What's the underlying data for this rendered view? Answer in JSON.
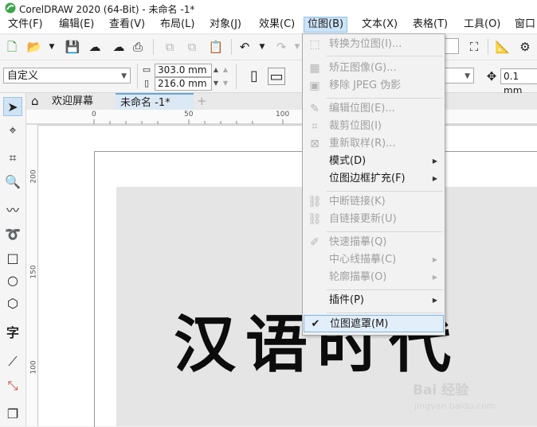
{
  "titlebar": {
    "title": "CorelDRAW 2020 (64-Bit) - 未命名 -1*",
    "icon": "coreldraw-logo"
  },
  "menubar": {
    "items": [
      "文件(F)",
      "编辑(E)",
      "查看(V)",
      "布局(L)",
      "对象(J)",
      "效果(C)",
      "位图(B)",
      "文本(X)",
      "表格(T)",
      "工具(O)",
      "窗口"
    ],
    "active_index": 6
  },
  "toolbar2": {
    "preset": "自定义",
    "width": "303.0 mm",
    "height": "216.0 mm",
    "nudge": "0.1 mm"
  },
  "tabs": {
    "welcome": "欢迎屏幕",
    "document": "未命名 -1*",
    "add": "+"
  },
  "rulers": {
    "h_labels": [
      "0",
      "50",
      "100"
    ],
    "v_labels": [
      "200",
      "150",
      "100"
    ]
  },
  "canvas": {
    "calligraphy_text": "汉语时代",
    "watermark": "Bai 经验",
    "watermark_url": "jingyan.baidu.com"
  },
  "bitmap_menu": {
    "items": [
      {
        "label": "转换为位图(I)...",
        "enabled": false,
        "icon": "convert-bitmap-icon"
      },
      {
        "label": "矫正图像(G)...",
        "enabled": false,
        "icon": "straighten-image-icon"
      },
      {
        "label": "移除 JPEG 伪影",
        "enabled": false,
        "icon": "jpeg-artifact-icon"
      },
      {
        "label": "编辑位图(E)...",
        "enabled": false,
        "icon": "edit-bitmap-icon"
      },
      {
        "label": "裁剪位图(I)",
        "enabled": false,
        "icon": "crop-bitmap-icon"
      },
      {
        "label": "重新取样(R)...",
        "enabled": false,
        "icon": "resample-icon"
      },
      {
        "label": "模式(D)",
        "enabled": true,
        "submenu": true
      },
      {
        "label": "位图边框扩充(F)",
        "enabled": true,
        "submenu": true
      },
      {
        "label": "中断链接(K)",
        "enabled": false,
        "icon": "break-link-icon"
      },
      {
        "label": "自链接更新(U)",
        "enabled": false,
        "icon": "update-link-icon"
      },
      {
        "label": "快速描摹(Q)",
        "enabled": false,
        "icon": "quick-trace-icon"
      },
      {
        "label": "中心线描摹(C)",
        "enabled": false,
        "submenu": true
      },
      {
        "label": "轮廓描摹(O)",
        "enabled": false,
        "submenu": true
      },
      {
        "label": "插件(P)",
        "enabled": true,
        "submenu": true
      },
      {
        "label": "位图遮罩(M)",
        "enabled": true,
        "checked": true,
        "highlighted": true
      }
    ],
    "check_mark": "✔",
    "submenu_arrow": "▶"
  },
  "colors": {
    "menu_highlight": "#cce4f7",
    "menu_border": "#8cc1ea",
    "tab_active": "#dce9f5"
  }
}
